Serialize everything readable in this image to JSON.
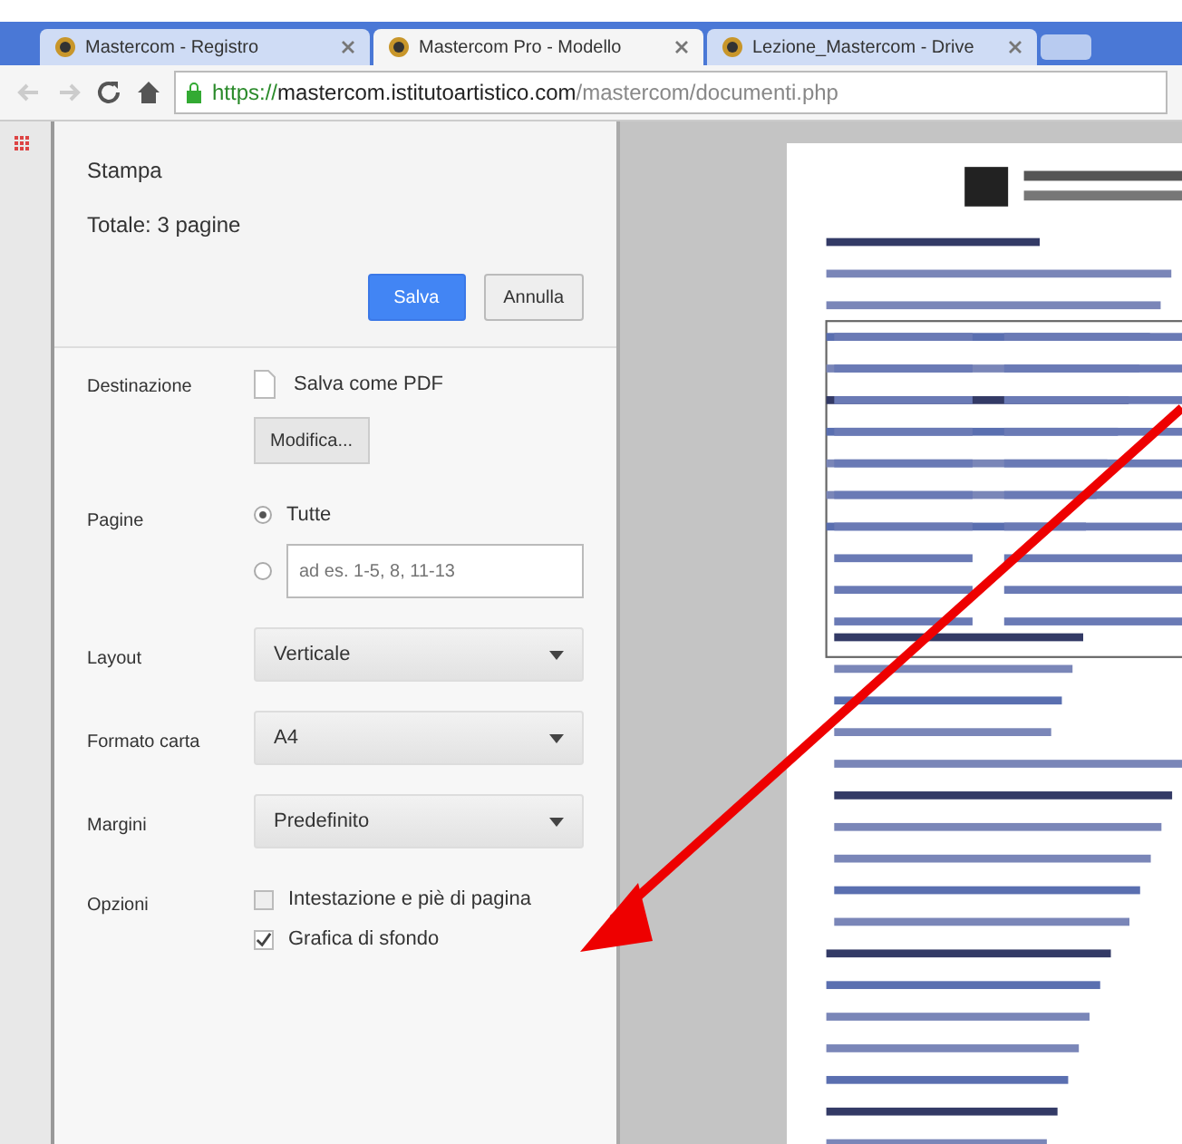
{
  "tabs": [
    {
      "title": "Mastercom - Registro",
      "selected": false
    },
    {
      "title": "Mastercom Pro - Modello",
      "selected": true
    },
    {
      "title": "Lezione_Mastercom - Drive",
      "selected": false
    }
  ],
  "address_bar": {
    "secure": "https://",
    "url": "mastercom.istitutoartistico.com",
    "path": "/mastercom/documenti.php"
  },
  "print_dialog": {
    "title": "Stampa",
    "total": "Totale: 3 pagine",
    "buttons": [
      {
        "label": "Salva",
        "primary": true
      },
      {
        "label": "Annulla",
        "primary": false
      }
    ],
    "destination": {
      "label": "Destinazione",
      "value": "Salva come PDF",
      "change": "Modifica..."
    },
    "pages": {
      "label": "Pagine",
      "options": [
        {
          "kind": "text",
          "label": "Tutte",
          "selected": true
        },
        {
          "kind": "input",
          "placeholder": "ad es. 1-5, 8, 11-13",
          "selected": false
        }
      ]
    },
    "selects": [
      {
        "label": "Layout",
        "value": "Verticale"
      },
      {
        "label": "Formato carta",
        "value": "A4"
      },
      {
        "label": "Margini",
        "value": "Predefinito"
      }
    ],
    "options": {
      "label": "Opzioni",
      "items": [
        {
          "label": "Intestazione e piè di pagina",
          "checked": false
        },
        {
          "label": "Grafica di sfondo",
          "checked": true
        }
      ]
    }
  }
}
